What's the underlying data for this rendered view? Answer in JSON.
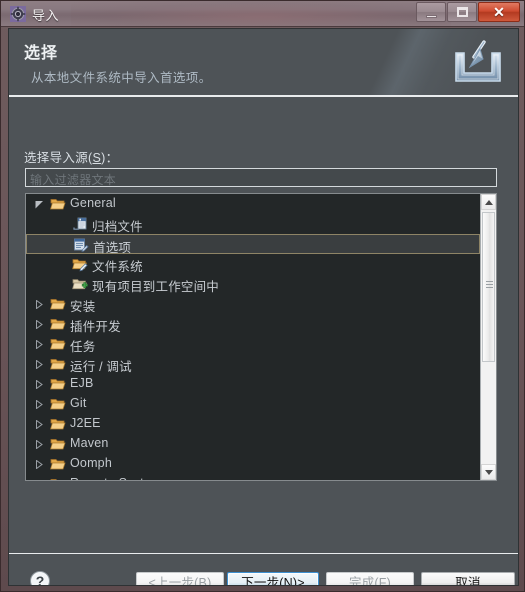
{
  "window": {
    "title": "导入",
    "icon": "eclipse-gear-icon",
    "caption_buttons": {
      "minimize": "minimize-icon",
      "maximize": "maximize-icon",
      "close": "✕"
    }
  },
  "banner": {
    "title": "选择",
    "description": "从本地文件系统中导入首选项。",
    "icon": "import-wizard-icon"
  },
  "form": {
    "source_label_pre": "选择导入源(",
    "source_label_key": "S",
    "source_label_post": ")：",
    "filter_placeholder": "输入过滤器文本",
    "filter_value": ""
  },
  "tree": {
    "selected_index": 2,
    "items": [
      {
        "label": "General",
        "depth": 0,
        "twisty": "expanded",
        "icon": "folder-open-icon",
        "lang": "en"
      },
      {
        "label": "归档文件",
        "depth": 1,
        "twisty": "none",
        "icon": "archive-file-icon",
        "lang": "cn"
      },
      {
        "label": "首选项",
        "depth": 1,
        "twisty": "none",
        "icon": "preferences-icon",
        "lang": "cn"
      },
      {
        "label": "文件系统",
        "depth": 1,
        "twisty": "none",
        "icon": "file-system-folder-icon",
        "lang": "cn"
      },
      {
        "label": "现有项目到工作空间中",
        "depth": 1,
        "twisty": "none",
        "icon": "existing-projects-icon",
        "lang": "cn"
      },
      {
        "label": "安装",
        "depth": 0,
        "twisty": "collapsed",
        "icon": "folder-open-icon",
        "lang": "cn"
      },
      {
        "label": "插件开发",
        "depth": 0,
        "twisty": "collapsed",
        "icon": "folder-open-icon",
        "lang": "cn"
      },
      {
        "label": "任务",
        "depth": 0,
        "twisty": "collapsed",
        "icon": "folder-open-icon",
        "lang": "cn"
      },
      {
        "label": "运行 / 调试",
        "depth": 0,
        "twisty": "collapsed",
        "icon": "folder-open-icon",
        "lang": "cn"
      },
      {
        "label": "EJB",
        "depth": 0,
        "twisty": "collapsed",
        "icon": "folder-open-icon",
        "lang": "en"
      },
      {
        "label": "Git",
        "depth": 0,
        "twisty": "collapsed",
        "icon": "folder-open-icon",
        "lang": "en"
      },
      {
        "label": "J2EE",
        "depth": 0,
        "twisty": "collapsed",
        "icon": "folder-open-icon",
        "lang": "en"
      },
      {
        "label": "Maven",
        "depth": 0,
        "twisty": "collapsed",
        "icon": "folder-open-icon",
        "lang": "en"
      },
      {
        "label": "Oomph",
        "depth": 0,
        "twisty": "collapsed",
        "icon": "folder-open-icon",
        "lang": "en"
      },
      {
        "label": "Remote Systems",
        "depth": 0,
        "twisty": "collapsed",
        "icon": "folder-open-icon",
        "lang": "en"
      }
    ]
  },
  "scrollbar": {
    "up_arrow": "scroll-up-icon",
    "down_arrow": "scroll-down-icon",
    "thumb": "scroll-thumb"
  },
  "buttons": {
    "help": "?",
    "back": {
      "pre": "<上一步(",
      "key": "B",
      "post": ")",
      "state": "disabled"
    },
    "next": {
      "pre": "下一步(",
      "key": "N",
      "post": ")>",
      "state": "default"
    },
    "finish": {
      "pre": "完成(",
      "key": "F",
      "post": ")",
      "state": "disabled"
    },
    "cancel": {
      "pre": "取消",
      "key": "",
      "post": "",
      "state": "normal"
    }
  },
  "colors": {
    "frame": "#6a5558",
    "client_bg": "#4e5357",
    "tree_bg": "#232728",
    "selection_border": "#8e8466",
    "default_button_border": "#3c8fd0",
    "separator": "#e9ecee",
    "folder": "#e8b464"
  }
}
